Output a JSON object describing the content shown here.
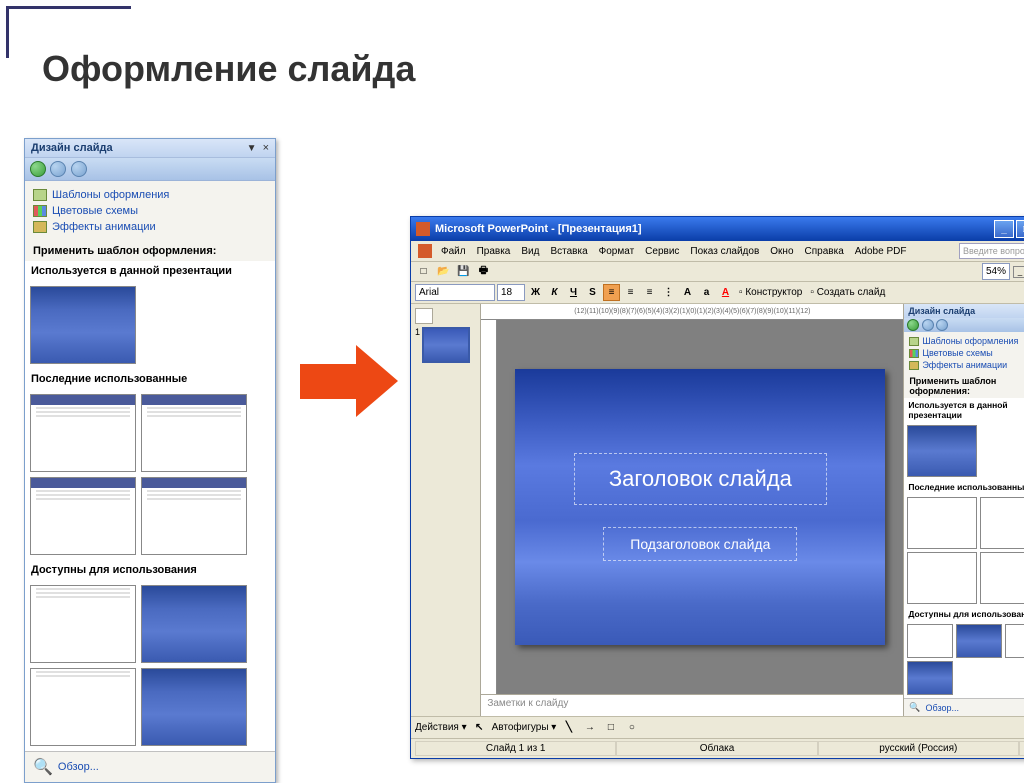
{
  "page": {
    "title": "Оформление слайда"
  },
  "taskpane_left": {
    "title": "Дизайн слайда",
    "links": {
      "templates": "Шаблоны оформления",
      "colors": "Цветовые схемы",
      "effects": "Эффекты анимации"
    },
    "apply_hdr": "Применить шаблон оформления:",
    "sec_used": "Используется в данной презентации",
    "sec_recent": "Последние использованные",
    "sec_avail": "Доступны для использования",
    "browse": "Обзор..."
  },
  "pp": {
    "title": "Microsoft PowerPoint - [Презентация1]",
    "menu": {
      "file": "Файл",
      "edit": "Правка",
      "view": "Вид",
      "insert": "Вставка",
      "format": "Формат",
      "tools": "Сервис",
      "slideshow": "Показ слайдов",
      "window": "Окно",
      "help": "Справка",
      "adobe": "Adobe PDF"
    },
    "search_placeholder": "Введите вопрос",
    "format_toolbar": {
      "font": "Arial",
      "size": "18",
      "designer": "Конструктор",
      "new_slide": "Создать слайд",
      "zoom": "54%"
    },
    "ruler": "(12)(11)(10)(9)(8)(7)(6)(5)(4)(3)(2)(1)(0)(1)(2)(3)(4)(5)(6)(7)(8)(9)(10)(11)(12)",
    "slide": {
      "title": "Заголовок слайда",
      "subtitle": "Подзаголовок слайда"
    },
    "thumb_num": "1",
    "notes": "Заметки к слайду",
    "draw": {
      "actions": "Действия",
      "autoshapes": "Автофигуры"
    },
    "status": {
      "slide": "Слайд 1 из 1",
      "template": "Облака",
      "lang": "русский (Россия)"
    },
    "taskpane": {
      "title": "Дизайн слайда",
      "links": {
        "templates": "Шаблоны оформления",
        "colors": "Цветовые схемы",
        "effects": "Эффекты анимации"
      },
      "apply_hdr": "Применить шаблон оформления:",
      "sec_used": "Используется в данной презентации",
      "sec_recent": "Последние использованные",
      "sec_avail": "Доступны для использования",
      "browse": "Обзор..."
    }
  }
}
